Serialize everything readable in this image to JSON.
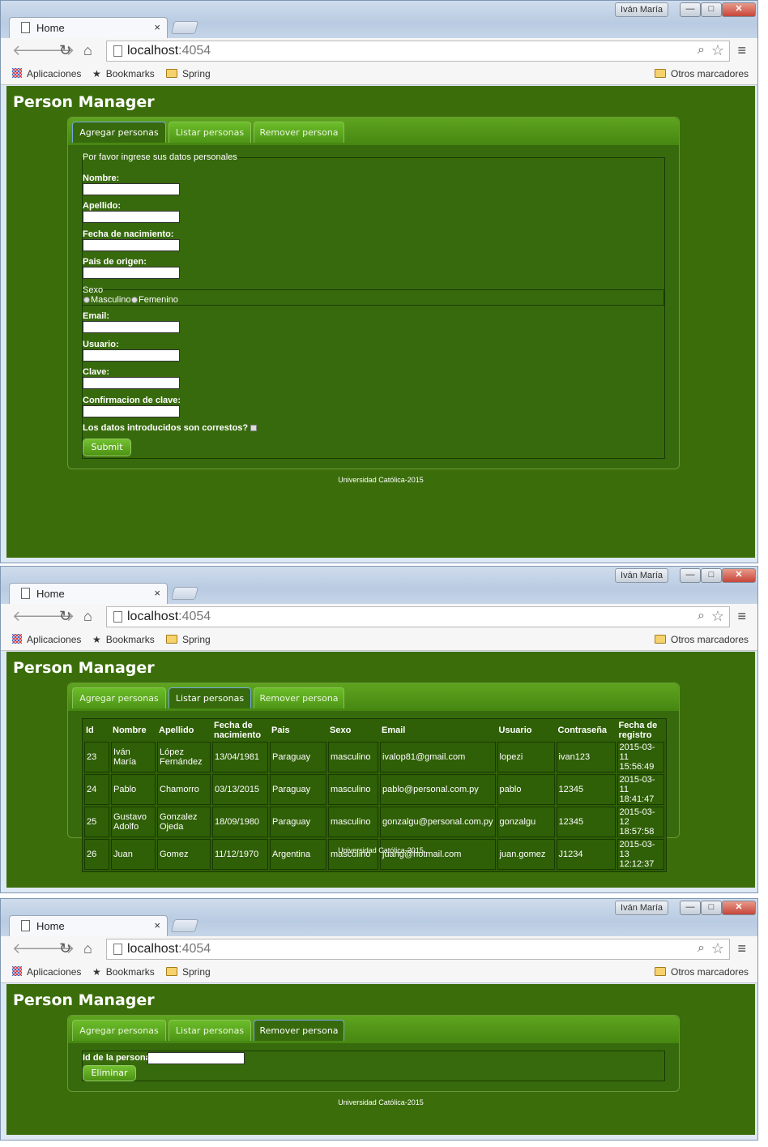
{
  "browser": {
    "user": "Iván María",
    "tab_title": "Home",
    "tab_close": "×",
    "url_host": "localhost",
    "url_port": ":4054",
    "bookmarks": {
      "apps": "Aplicaciones",
      "bookmarks": "Bookmarks",
      "spring": "Spring",
      "other": "Otros marcadores"
    }
  },
  "app": {
    "title": "Person Manager",
    "tabs": {
      "agregar": "Agregar personas",
      "listar": "Listar personas",
      "remover": "Remover persona"
    },
    "footer": "Universidad Católica-2015"
  },
  "form": {
    "legend": "Por favor ingrese sus datos personales",
    "nombre": "Nombre:",
    "apellido": "Apellido:",
    "fecha": "Fecha de nacimiento:",
    "pais": "Pais de origen:",
    "sexo_legend": "Sexo",
    "masculino": "Masculino",
    "femenino": "Femenino",
    "email": "Email:",
    "usuario": "Usuario:",
    "clave": "Clave:",
    "confirmacion": "Confirmacion de clave:",
    "correctos": "Los datos introducidos son correstos?",
    "submit": "Submit"
  },
  "list": {
    "headers": [
      "Id",
      "Nombre",
      "Apellido",
      "Fecha de nacimiento",
      "Pais",
      "Sexo",
      "Email",
      "Usuario",
      "Contraseña",
      "Fecha de registro"
    ],
    "rows": [
      [
        "23",
        "Iván María",
        "López Fernández",
        "13/04/1981",
        "Paraguay",
        "masculino",
        "ivalop81@gmail.com",
        "lopezi",
        "ivan123",
        "2015-03-11 15:56:49"
      ],
      [
        "24",
        "Pablo",
        "Chamorro",
        "03/13/2015",
        "Paraguay",
        "masculino",
        "pablo@personal.com.py",
        "pablo",
        "12345",
        "2015-03-11 18:41:47"
      ],
      [
        "25",
        "Gustavo Adolfo",
        "Gonzalez Ojeda",
        "18/09/1980",
        "Paraguay",
        "masculino",
        "gonzalgu@personal.com.py",
        "gonzalgu",
        "12345",
        "2015-03-12 18:57:58"
      ],
      [
        "26",
        "Juan",
        "Gomez",
        "11/12/1970",
        "Argentina",
        "masculino",
        "juang@hotmail.com",
        "juan.gomez",
        "J1234",
        "2015-03-13 12:12:37"
      ]
    ]
  },
  "remove": {
    "label": "Id de la persona",
    "button": "Eliminar"
  }
}
